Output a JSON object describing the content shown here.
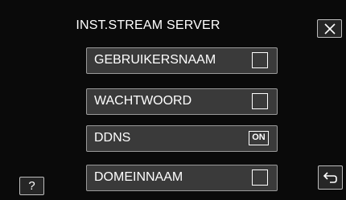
{
  "header": {
    "title": "INST.STREAM SERVER"
  },
  "menu": {
    "items": [
      {
        "label": "GEBRUIKERSNAAM",
        "control": "checkbox",
        "checked": false
      },
      {
        "label": "WACHTWOORD",
        "control": "checkbox",
        "checked": false
      },
      {
        "label": "DDNS",
        "control": "toggle",
        "state": "ON"
      },
      {
        "label": "DOMEINNAAM",
        "control": "checkbox",
        "checked": false
      }
    ]
  },
  "buttons": {
    "help_label": "?",
    "close_icon": "close-icon",
    "back_icon": "return-arrow-icon"
  },
  "colors": {
    "background": "#0a0a0a",
    "item_fill": "#3a3a3a",
    "item_border": "#9a9a9a",
    "text": "#ffffff"
  }
}
